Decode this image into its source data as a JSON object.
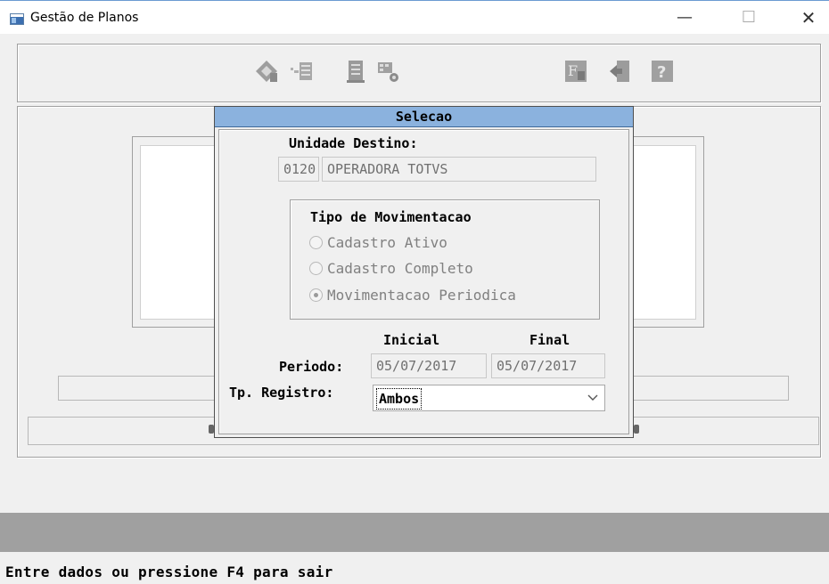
{
  "window": {
    "title": "Gestão de Planos",
    "controls": {
      "minimize": "—",
      "maximize": "☐",
      "close": "✕"
    }
  },
  "toolbar": {
    "buttons": [
      {
        "name": "edit-icon",
        "enabled": false
      },
      {
        "name": "list-icon",
        "enabled": false
      },
      {
        "name": "document-icon",
        "enabled": false
      },
      {
        "name": "settings-grid-icon",
        "enabled": false
      },
      {
        "name": "font-icon",
        "enabled": false
      },
      {
        "name": "exit-door-icon",
        "enabled": false
      },
      {
        "name": "help-icon",
        "enabled": false
      }
    ]
  },
  "dialog": {
    "title": "Selecao",
    "unidade_label": "Unidade Destino:",
    "unidade_code": "0120",
    "unidade_name": "OPERADORA TOTVS",
    "tipo_group_label": "Tipo de Movimentacao",
    "tipo_options": [
      {
        "label": "Cadastro Ativo",
        "checked": false
      },
      {
        "label": "Cadastro Completo",
        "checked": false
      },
      {
        "label": "Movimentacao Periodica",
        "checked": true
      }
    ],
    "inicial_label": "Inicial",
    "final_label": "Final",
    "periodo_label": "Periodo:",
    "periodo_inicial": "05/07/2017",
    "periodo_final": "05/07/2017",
    "registro_label": "Tp. Registro:",
    "registro_value": "Ambos"
  },
  "status_bar": {
    "message": "Entre dados ou pressione F4 para sair"
  },
  "colors": {
    "dialog_title_bg": "#8bb2de",
    "bottom_bar": "#a0a0a0",
    "window_bg": "#f0f0f0"
  }
}
